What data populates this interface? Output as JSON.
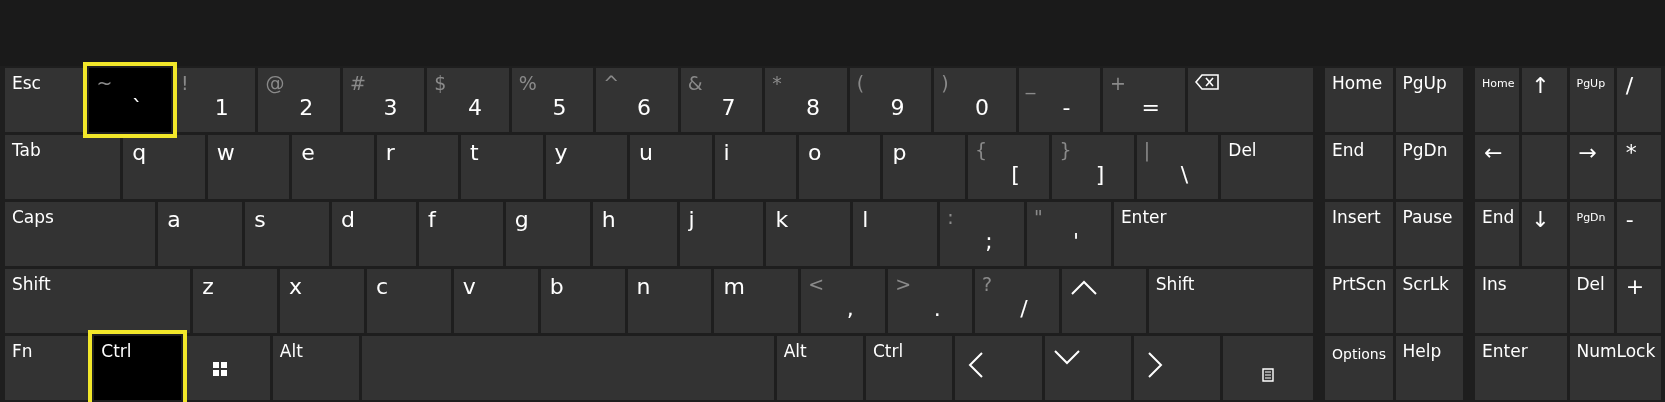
{
  "main": [
    {
      "keys": [
        {
          "kind": "label",
          "main": "Esc",
          "highlighted": false
        },
        {
          "kind": "dual",
          "shift": "~",
          "main": "`",
          "highlighted": true
        },
        {
          "kind": "dual",
          "shift": "!",
          "main": "1",
          "highlighted": false
        },
        {
          "kind": "dual",
          "shift": "@",
          "main": "2",
          "highlighted": false
        },
        {
          "kind": "dual",
          "shift": "#",
          "main": "3",
          "highlighted": false
        },
        {
          "kind": "dual",
          "shift": "$",
          "main": "4",
          "highlighted": false
        },
        {
          "kind": "dual",
          "shift": "%",
          "main": "5",
          "highlighted": false
        },
        {
          "kind": "dual",
          "shift": "^",
          "main": "6",
          "highlighted": false
        },
        {
          "kind": "dual",
          "shift": "&",
          "main": "7",
          "highlighted": false
        },
        {
          "kind": "dual",
          "shift": "*",
          "main": "8",
          "highlighted": false
        },
        {
          "kind": "dual",
          "shift": "(",
          "main": "9",
          "highlighted": false
        },
        {
          "kind": "dual",
          "shift": ")",
          "main": "0",
          "highlighted": false
        },
        {
          "kind": "dual",
          "shift": "_",
          "main": "-",
          "highlighted": false
        },
        {
          "kind": "dual",
          "shift": "+",
          "main": "=",
          "highlighted": false
        },
        {
          "kind": "backspace",
          "highlighted": false
        }
      ]
    },
    {
      "keys": [
        {
          "kind": "label",
          "main": "Tab",
          "highlighted": false
        },
        {
          "kind": "letter",
          "main": "q",
          "highlighted": false
        },
        {
          "kind": "letter",
          "main": "w",
          "highlighted": false
        },
        {
          "kind": "letter",
          "main": "e",
          "highlighted": false
        },
        {
          "kind": "letter",
          "main": "r",
          "highlighted": false
        },
        {
          "kind": "letter",
          "main": "t",
          "highlighted": false
        },
        {
          "kind": "letter",
          "main": "y",
          "highlighted": false
        },
        {
          "kind": "letter",
          "main": "u",
          "highlighted": false
        },
        {
          "kind": "letter",
          "main": "i",
          "highlighted": false
        },
        {
          "kind": "letter",
          "main": "o",
          "highlighted": false
        },
        {
          "kind": "letter",
          "main": "p",
          "highlighted": false
        },
        {
          "kind": "dual",
          "shift": "{",
          "main": "[",
          "highlighted": false
        },
        {
          "kind": "dual",
          "shift": "}",
          "main": "]",
          "highlighted": false
        },
        {
          "kind": "dual",
          "shift": "|",
          "main": "\\",
          "highlighted": false
        },
        {
          "kind": "label",
          "main": "Del",
          "highlighted": false
        }
      ]
    },
    {
      "keys": [
        {
          "kind": "label",
          "main": "Caps",
          "highlighted": false
        },
        {
          "kind": "letter",
          "main": "a",
          "highlighted": false
        },
        {
          "kind": "letter",
          "main": "s",
          "highlighted": false
        },
        {
          "kind": "letter",
          "main": "d",
          "highlighted": false
        },
        {
          "kind": "letter",
          "main": "f",
          "highlighted": false
        },
        {
          "kind": "letter",
          "main": "g",
          "highlighted": false
        },
        {
          "kind": "letter",
          "main": "h",
          "highlighted": false
        },
        {
          "kind": "letter",
          "main": "j",
          "highlighted": false
        },
        {
          "kind": "letter",
          "main": "k",
          "highlighted": false
        },
        {
          "kind": "letter",
          "main": "l",
          "highlighted": false
        },
        {
          "kind": "dual",
          "shift": ":",
          "main": ";",
          "highlighted": false
        },
        {
          "kind": "dual",
          "shift": "\"",
          "main": "'",
          "highlighted": false
        },
        {
          "kind": "label",
          "main": "Enter",
          "highlighted": false
        }
      ]
    },
    {
      "keys": [
        {
          "kind": "label",
          "main": "Shift",
          "highlighted": false
        },
        {
          "kind": "letter",
          "main": "z",
          "highlighted": false
        },
        {
          "kind": "letter",
          "main": "x",
          "highlighted": false
        },
        {
          "kind": "letter",
          "main": "c",
          "highlighted": false
        },
        {
          "kind": "letter",
          "main": "v",
          "highlighted": false
        },
        {
          "kind": "letter",
          "main": "b",
          "highlighted": false
        },
        {
          "kind": "letter",
          "main": "n",
          "highlighted": false
        },
        {
          "kind": "letter",
          "main": "m",
          "highlighted": false
        },
        {
          "kind": "dual",
          "shift": "<",
          "main": ",",
          "highlighted": false
        },
        {
          "kind": "dual",
          "shift": ">",
          "main": ".",
          "highlighted": false
        },
        {
          "kind": "dual",
          "shift": "?",
          "main": "/",
          "highlighted": false
        },
        {
          "kind": "arrow-up",
          "highlighted": false
        },
        {
          "kind": "label",
          "main": "Shift",
          "highlighted": false
        }
      ]
    },
    {
      "keys": [
        {
          "kind": "label",
          "main": "Fn",
          "highlighted": false
        },
        {
          "kind": "label",
          "main": "Ctrl",
          "highlighted": true
        },
        {
          "kind": "windows",
          "highlighted": false
        },
        {
          "kind": "label",
          "main": "Alt",
          "highlighted": false
        },
        {
          "kind": "blank",
          "highlighted": false
        },
        {
          "kind": "label",
          "main": "Alt",
          "highlighted": false
        },
        {
          "kind": "label",
          "main": "Ctrl",
          "highlighted": false
        },
        {
          "kind": "arrow-left",
          "highlighted": false
        },
        {
          "kind": "arrow-down",
          "highlighted": false
        },
        {
          "kind": "arrow-right",
          "highlighted": false
        },
        {
          "kind": "menu",
          "highlighted": false
        }
      ]
    }
  ],
  "navigation": [
    {
      "keys": [
        {
          "kind": "label",
          "main": "Home",
          "highlighted": false
        },
        {
          "kind": "label",
          "main": "PgUp",
          "highlighted": false
        }
      ]
    },
    {
      "keys": [
        {
          "kind": "label",
          "main": "End",
          "highlighted": false
        },
        {
          "kind": "label",
          "main": "PgDn",
          "highlighted": false
        }
      ]
    },
    {
      "keys": [
        {
          "kind": "label",
          "main": "Insert",
          "highlighted": false
        },
        {
          "kind": "label",
          "main": "Pause",
          "highlighted": false
        }
      ]
    },
    {
      "keys": [
        {
          "kind": "label",
          "main": "PrtScn",
          "highlighted": false
        },
        {
          "kind": "label",
          "main": "ScrLk",
          "highlighted": false
        }
      ]
    },
    {
      "keys": [
        {
          "kind": "small-label",
          "main": "Options",
          "highlighted": false
        },
        {
          "kind": "label",
          "main": "Help",
          "highlighted": false
        }
      ]
    }
  ],
  "numpad": [
    {
      "keys": [
        {
          "kind": "tiny-label",
          "main": "Home",
          "highlighted": false
        },
        {
          "kind": "letter",
          "main": "↑",
          "highlighted": false
        },
        {
          "kind": "tiny-label",
          "main": "PgUp",
          "highlighted": false
        },
        {
          "kind": "letter",
          "main": "/",
          "highlighted": false
        }
      ]
    },
    {
      "keys": [
        {
          "kind": "letter",
          "main": "←",
          "highlighted": false
        },
        {
          "kind": "blank",
          "highlighted": false
        },
        {
          "kind": "letter",
          "main": "→",
          "highlighted": false
        },
        {
          "kind": "letter",
          "main": "*",
          "highlighted": false
        }
      ]
    },
    {
      "keys": [
        {
          "kind": "label",
          "main": "End",
          "highlighted": false
        },
        {
          "kind": "letter",
          "main": "↓",
          "highlighted": false
        },
        {
          "kind": "tiny-label",
          "main": "PgDn",
          "highlighted": false
        },
        {
          "kind": "letter",
          "main": "-",
          "highlighted": false
        }
      ]
    },
    {
      "keys": [
        {
          "kind": "label",
          "main": "Ins",
          "highlighted": false
        },
        {
          "kind": "label",
          "main": "Del",
          "highlighted": false
        },
        {
          "kind": "letter",
          "main": "+",
          "highlighted": false
        }
      ]
    },
    {
      "keys": [
        {
          "kind": "label",
          "main": "Enter",
          "highlighted": false
        },
        {
          "kind": "label",
          "main": "NumLock",
          "highlighted": false
        }
      ]
    }
  ]
}
